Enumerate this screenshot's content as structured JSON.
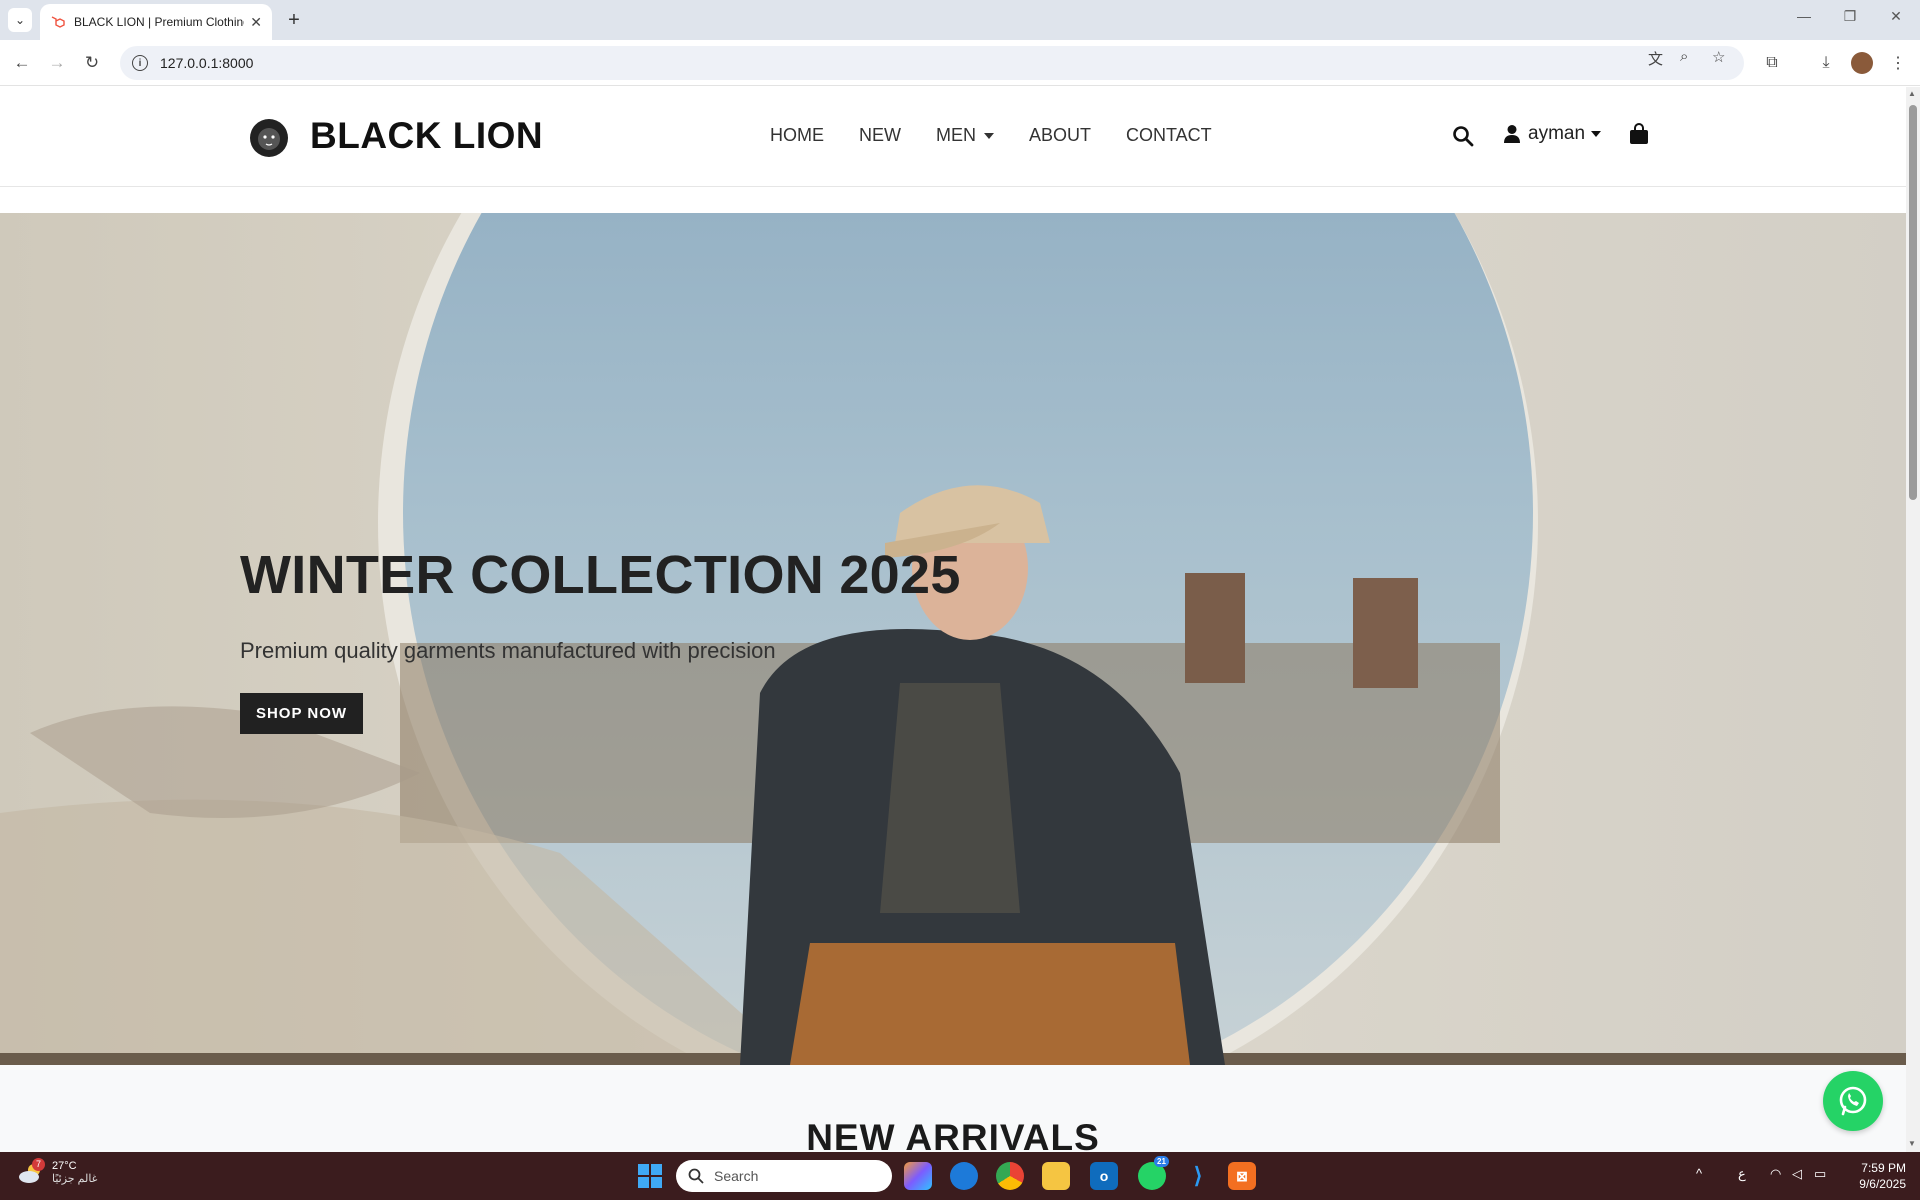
{
  "browser": {
    "tab_title": "BLACK LION | Premium Clothing",
    "url": "127.0.0.1:8000"
  },
  "site": {
    "brand": "BLACK LION",
    "nav": [
      {
        "label": "HOME"
      },
      {
        "label": "NEW"
      },
      {
        "label": "MEN",
        "has_dropdown": true
      },
      {
        "label": "ABOUT"
      },
      {
        "label": "CONTACT"
      }
    ],
    "user_name": "ayman"
  },
  "hero": {
    "title": "WINTER COLLECTION 2025",
    "subtitle": "Premium quality garments manufactured with precision",
    "button": "SHOP NOW"
  },
  "section": {
    "heading": "NEW ARRIVALS"
  },
  "taskbar": {
    "weather_temp": "27°C",
    "weather_desc": "غالم جزئيًا",
    "weather_badge": "7",
    "search_placeholder": "Search",
    "whatsapp_badge": "21",
    "lang": "ع",
    "time": "7:59 PM",
    "date": "9/6/2025"
  },
  "colors": {
    "accent_dark": "#212121",
    "whatsapp": "#25d366",
    "taskbar": "#3b1c1e"
  }
}
